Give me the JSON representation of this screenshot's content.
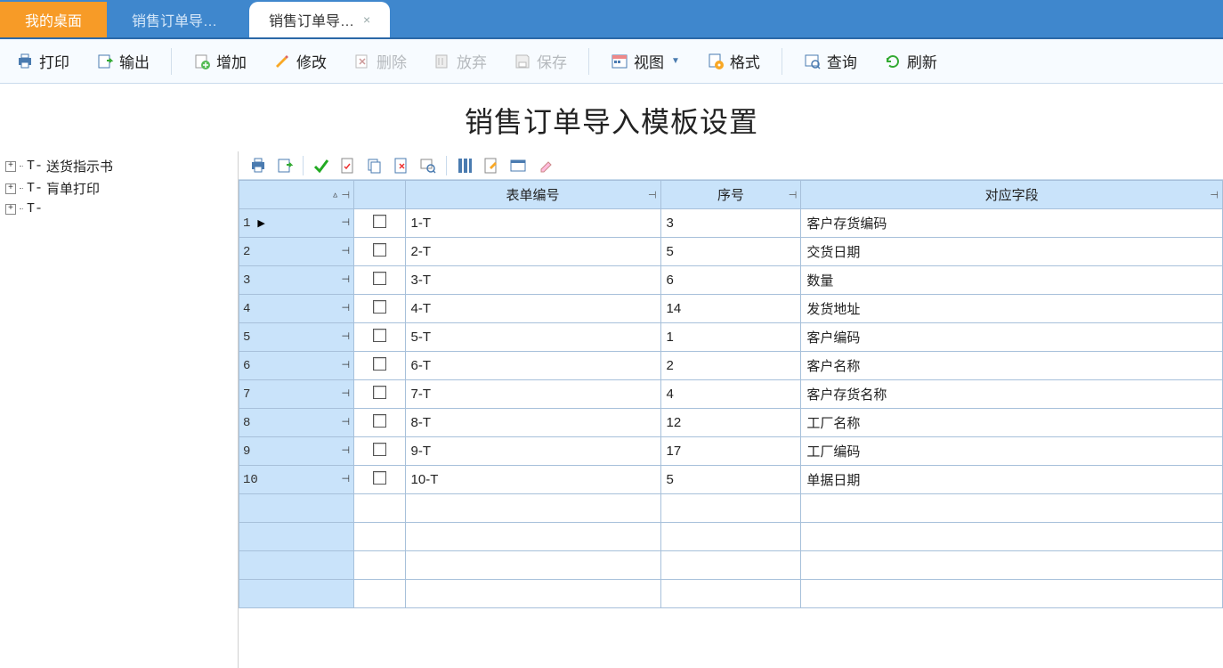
{
  "tabs": {
    "t0": "我的桌面",
    "t1": "销售订单导…",
    "t2": "销售订单导…",
    "close": "×"
  },
  "toolbar": {
    "print": "打印",
    "output": "输出",
    "add": "增加",
    "edit": "修改",
    "delete": "删除",
    "abandon": "放弃",
    "save": "保存",
    "view": "视图",
    "format": "格式",
    "search": "查询",
    "refresh": "刷新"
  },
  "page_title": "销售订单导入模板设置",
  "tree": [
    {
      "code": "T-",
      "label": "送货指示书"
    },
    {
      "code": "T-",
      "label": "肓单打印"
    },
    {
      "code": "T-",
      "label": ""
    }
  ],
  "grid": {
    "headers": {
      "form_no": "表单编号",
      "seq": "序号",
      "field": "对应字段"
    },
    "rows": [
      {
        "n": "1",
        "form": "1-T",
        "seq": "3",
        "field": "客户存货编码",
        "current": true
      },
      {
        "n": "2",
        "form": "2-T",
        "seq": "5",
        "field": "交货日期"
      },
      {
        "n": "3",
        "form": "3-T",
        "seq": "6",
        "field": "数量"
      },
      {
        "n": "4",
        "form": "4-T",
        "seq": "14",
        "field": "发货地址"
      },
      {
        "n": "5",
        "form": "5-T",
        "seq": "1",
        "field": "客户编码"
      },
      {
        "n": "6",
        "form": "6-T",
        "seq": "2",
        "field": "客户名称"
      },
      {
        "n": "7",
        "form": "7-T",
        "seq": "4",
        "field": "客户存货名称"
      },
      {
        "n": "8",
        "form": "8-T",
        "seq": "12",
        "field": "工厂名称"
      },
      {
        "n": "9",
        "form": "9-T",
        "seq": "17",
        "field": "工厂编码"
      },
      {
        "n": "10",
        "form": "10-T",
        "seq": "5",
        "field": "单据日期"
      }
    ],
    "empty_rows": 4
  }
}
